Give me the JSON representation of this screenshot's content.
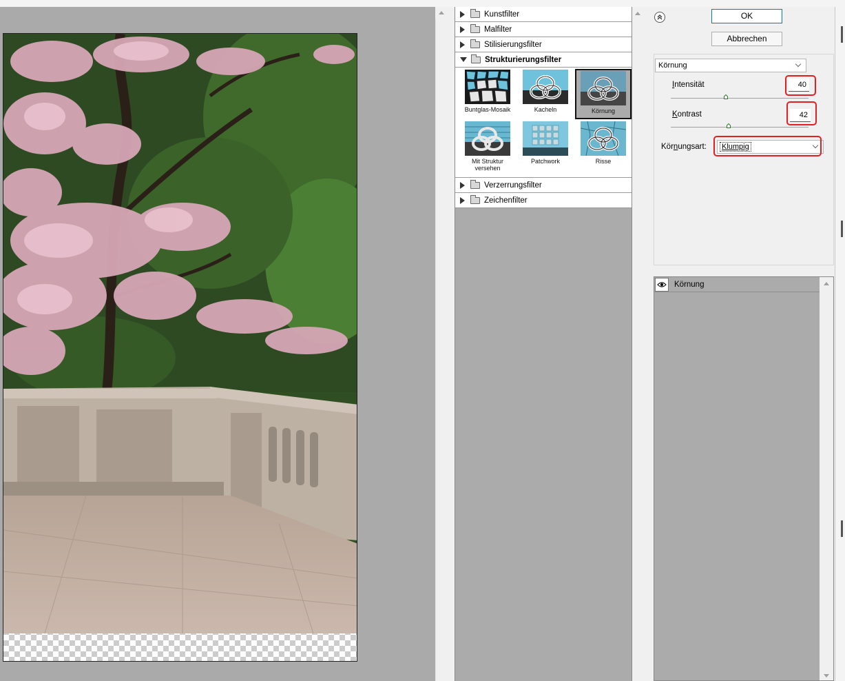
{
  "gallery": {
    "categories_top": [
      {
        "label": "Kunstfilter"
      },
      {
        "label": "Malfilter"
      },
      {
        "label": "Stilisierungsfilter"
      }
    ],
    "open_category": {
      "label": "Strukturierungsfilter"
    },
    "filters": [
      {
        "label": "Buntglas-Mosaik",
        "selected": false
      },
      {
        "label": "Kacheln",
        "selected": false
      },
      {
        "label": "Körnung",
        "selected": true
      },
      {
        "label": "Mit Struktur versehen",
        "selected": false
      },
      {
        "label": "Patchwork",
        "selected": false
      },
      {
        "label": "Risse",
        "selected": false
      }
    ],
    "categories_bottom": [
      {
        "label": "Verzerrungsfilter"
      },
      {
        "label": "Zeichenfilter"
      }
    ]
  },
  "dialog": {
    "ok_label": "OK",
    "cancel_label": "Abbrechen"
  },
  "params": {
    "filter_select": "Körnung",
    "intensity": {
      "label_prefix": "",
      "label_key": "I",
      "label_rest": "ntensität",
      "value": "40",
      "min": 0,
      "max": 100
    },
    "contrast": {
      "label_prefix": "",
      "label_key": "K",
      "label_rest": "ontrast",
      "value": "42",
      "min": 0,
      "max": 100
    },
    "grain_type": {
      "label_prefix": "Kör",
      "label_key": "n",
      "label_rest": "ungsart:",
      "value": "Klumpig"
    }
  },
  "layers": [
    {
      "label": "Körnung",
      "visible": true
    }
  ],
  "colors": {
    "highlight": "#e02020",
    "ok_border": "#0078d7",
    "panel_gray": "#ababab"
  }
}
